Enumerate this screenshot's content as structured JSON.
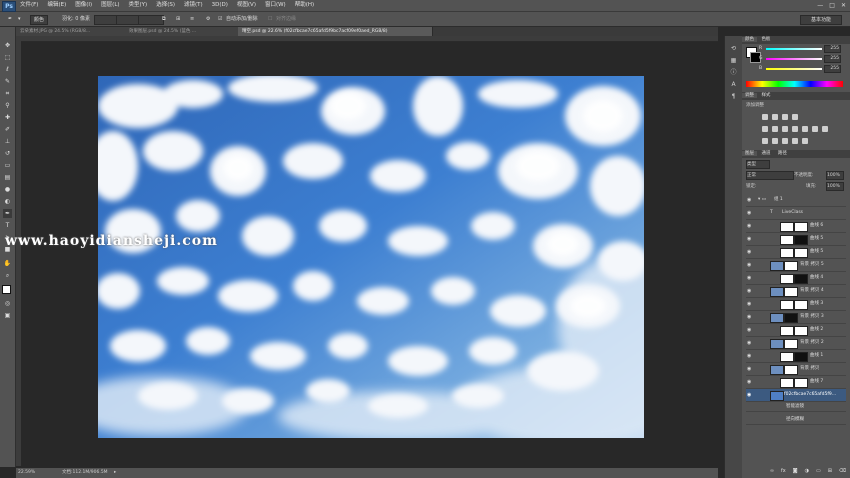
{
  "app": {
    "logo": "Ps"
  },
  "menu": [
    "文件(F)",
    "编辑(E)",
    "图像(I)",
    "图层(L)",
    "类型(Y)",
    "选择(S)",
    "滤镜(T)",
    "3D(D)",
    "视图(V)",
    "窗口(W)",
    "帮助(H)"
  ],
  "window_controls": [
    "—",
    "□",
    "✕"
  ],
  "options": {
    "mode": "颜色",
    "feather": "羽化: 0 像素",
    "auto_add": "自动添加/删除",
    "align": "对齐边缘",
    "workspace": "基本功能"
  },
  "tabs": [
    "云朵素材.JPG @ 24.5% (RGB/8...",
    "效果图层.psd @ 24.5% (蓝色 ...",
    "晴空.psd @ 22.6% (f02cfbcae7c65afd5f9bc7acf09ef0aed_RGB/8)"
  ],
  "status": {
    "zoom": "22.59%",
    "doc": "文档:112.1M/906.5M"
  },
  "color_panel": {
    "tabs": [
      "颜色",
      "色板"
    ],
    "channels": [
      {
        "label": "R",
        "value": "255",
        "color": "#ff3b3b"
      },
      {
        "label": "G",
        "value": "255",
        "color": "#35d14a"
      },
      {
        "label": "B",
        "value": "255",
        "color": "#3b6bff"
      }
    ]
  },
  "adjust_panel": {
    "tabs": [
      "调整",
      "样式"
    ],
    "title": "添加调整"
  },
  "layers_panel": {
    "tabs": [
      "图层",
      "通道",
      "路径"
    ],
    "kind": "类型",
    "blend": "正常",
    "opacity_label": "不透明度:",
    "opacity": "100%",
    "lock_label": "锁定:",
    "fill_label": "填充:",
    "fill": "100%",
    "layers": [
      {
        "name": "组 1",
        "type": "group"
      },
      {
        "name": "LiveClass",
        "type": "text"
      },
      {
        "name": "曲线 6",
        "type": "adj"
      },
      {
        "name": "曲线 5",
        "type": "adj"
      },
      {
        "name": "曲线 5",
        "type": "adj"
      },
      {
        "name": "背景 拷贝 5",
        "type": "img"
      },
      {
        "name": "曲线 4",
        "type": "adj"
      },
      {
        "name": "背景 拷贝 4",
        "type": "img"
      },
      {
        "name": "曲线 3",
        "type": "adj"
      },
      {
        "name": "背景 拷贝 3",
        "type": "img"
      },
      {
        "name": "曲线 2",
        "type": "adj"
      },
      {
        "name": "背景 拷贝 2",
        "type": "img"
      },
      {
        "name": "曲线 1",
        "type": "adj"
      },
      {
        "name": "背景 拷贝",
        "type": "img"
      },
      {
        "name": "曲线 7",
        "type": "adj"
      },
      {
        "name": "f02cfbcae7c65afd5f9...",
        "type": "smart"
      },
      {
        "name": "智能滤镜",
        "type": "filter"
      },
      {
        "name": "径向模糊",
        "type": "filter"
      }
    ]
  },
  "watermark": "www.haoyidiansheji.com",
  "icons": {
    "toolbar": [
      "move-icon",
      "marquee-icon",
      "lasso-icon",
      "quick-select-icon",
      "crop-icon",
      "eyedropper-icon",
      "healing-icon",
      "brush-icon",
      "stamp-icon",
      "history-brush-icon",
      "eraser-icon",
      "gradient-icon",
      "blur-icon",
      "dodge-icon",
      "pen-icon",
      "type-icon",
      "path-select-icon",
      "shape-icon",
      "hand-icon",
      "zoom-icon"
    ]
  }
}
